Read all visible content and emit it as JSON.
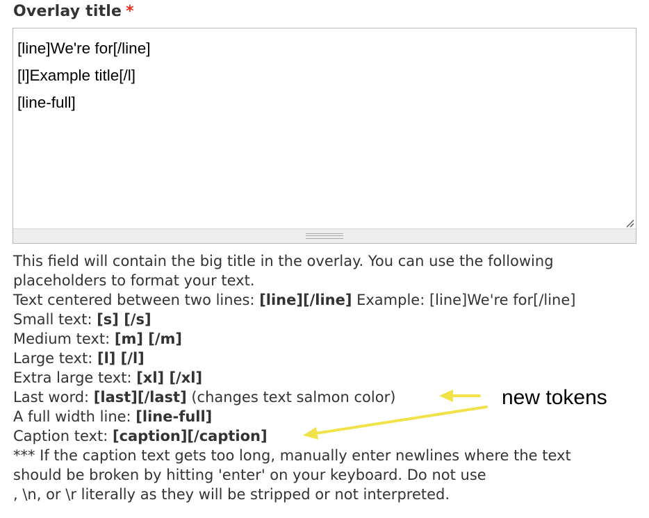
{
  "field": {
    "label": "Overlay title",
    "required_mark": "*",
    "value_lines": [
      "[line]We're for[/line]",
      "[l]Example title[/l]",
      "[line-full]"
    ]
  },
  "description": {
    "intro_1": "This field will contain the big title in the overlay. You can use the following",
    "intro_2": "placeholders to format your text.",
    "items": [
      {
        "label": "Text centered between two lines: ",
        "tokens": "[line][/line]",
        "suffix": " Example: [line]We're for[/line]"
      },
      {
        "label": "Small text: ",
        "tokens": "[s] [/s]",
        "suffix": ""
      },
      {
        "label": "Medium text: ",
        "tokens": "[m] [/m]",
        "suffix": ""
      },
      {
        "label": "Large text: ",
        "tokens": "[l] [/l]",
        "suffix": ""
      },
      {
        "label": "Extra large text: ",
        "tokens": "[xl] [/xl]",
        "suffix": ""
      },
      {
        "label": "Last word: ",
        "tokens": "[last][/last]",
        "suffix": " (changes text salmon color)"
      },
      {
        "label": "A full width line: ",
        "tokens": "[line-full]",
        "suffix": ""
      },
      {
        "label": "Caption text: ",
        "tokens": "[caption][/caption]",
        "suffix": ""
      }
    ],
    "note_1": "*** If the caption text gets too long, manually enter newlines where the text",
    "note_2": "should be broken by hitting 'enter' on your keyboard. Do not use",
    "note_3": ", \\n, or \\r literally as they will be stripped or not interpreted."
  },
  "annotation": {
    "text": "new tokens",
    "arrow_color": "#f2e24a"
  },
  "colors": {
    "required": "#e0301e",
    "text": "#333333"
  }
}
